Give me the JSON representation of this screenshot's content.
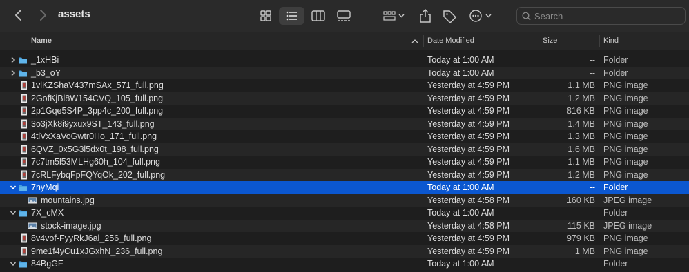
{
  "toolbar": {
    "title": "assets",
    "search_placeholder": "Search",
    "icons": [
      "chevron-left-icon",
      "chevron-right-icon",
      "grid-view-icon",
      "list-view-icon",
      "column-view-icon",
      "gallery-view-icon",
      "group-icon",
      "share-icon",
      "tag-icon",
      "more-icon",
      "search-icon"
    ]
  },
  "columns": {
    "name": "Name",
    "date": "Date Modified",
    "size": "Size",
    "kind": "Kind"
  },
  "colors": {
    "selection": "#0b57d0",
    "folder": "#4aa3df"
  },
  "rows": [
    {
      "name": "_1xHBi",
      "date": "Today at 1:00 AM",
      "size": "--",
      "kind": "Folder",
      "type": "folder",
      "disclosure": "collapsed",
      "indent": 0
    },
    {
      "name": "_b3_oY",
      "date": "Today at 1:00 AM",
      "size": "--",
      "kind": "Folder",
      "type": "folder",
      "disclosure": "collapsed",
      "indent": 0
    },
    {
      "name": "1vlKZShaV437mSAx_571_full.png",
      "date": "Yesterday at 4:59 PM",
      "size": "1.1 MB",
      "kind": "PNG image",
      "type": "png",
      "indent": 0
    },
    {
      "name": "2GofKjBl8W154CVQ_105_full.png",
      "date": "Yesterday at 4:59 PM",
      "size": "1.2 MB",
      "kind": "PNG image",
      "type": "png",
      "indent": 0
    },
    {
      "name": "2p1Gqe5S4P_3pp4c_200_full.png",
      "date": "Yesterday at 4:59 PM",
      "size": "816 KB",
      "kind": "PNG image",
      "type": "png",
      "indent": 0
    },
    {
      "name": "3o3jXk8i9yxux9ST_143_full.png",
      "date": "Yesterday at 4:59 PM",
      "size": "1.4 MB",
      "kind": "PNG image",
      "type": "png",
      "indent": 0
    },
    {
      "name": "4tlVxXaVoGwtr0Ho_171_full.png",
      "date": "Yesterday at 4:59 PM",
      "size": "1.3 MB",
      "kind": "PNG image",
      "type": "png",
      "indent": 0
    },
    {
      "name": "6QVZ_0x5G3l5dx0t_198_full.png",
      "date": "Yesterday at 4:59 PM",
      "size": "1.6 MB",
      "kind": "PNG image",
      "type": "png",
      "indent": 0
    },
    {
      "name": "7c7tm5l53MLHg60h_104_full.png",
      "date": "Yesterday at 4:59 PM",
      "size": "1.1 MB",
      "kind": "PNG image",
      "type": "png",
      "indent": 0
    },
    {
      "name": "7cRLFybqFpFQYqOk_202_full.png",
      "date": "Yesterday at 4:59 PM",
      "size": "1.2 MB",
      "kind": "PNG image",
      "type": "png",
      "indent": 0
    },
    {
      "name": "7nyMqi",
      "date": "Today at 1:00 AM",
      "size": "--",
      "kind": "Folder",
      "type": "folder",
      "disclosure": "expanded",
      "indent": 0,
      "selected": true
    },
    {
      "name": "mountains.jpg",
      "date": "Yesterday at 4:58 PM",
      "size": "160 KB",
      "kind": "JPEG image",
      "type": "jpg",
      "indent": 1
    },
    {
      "name": "7X_cMX",
      "date": "Today at 1:00 AM",
      "size": "--",
      "kind": "Folder",
      "type": "folder",
      "disclosure": "expanded",
      "indent": 0
    },
    {
      "name": "stock-image.jpg",
      "date": "Yesterday at 4:58 PM",
      "size": "115 KB",
      "kind": "JPEG image",
      "type": "jpg",
      "indent": 1
    },
    {
      "name": "8v4vof-FyyRkJ6al_256_full.png",
      "date": "Yesterday at 4:59 PM",
      "size": "979 KB",
      "kind": "PNG image",
      "type": "png",
      "indent": 0
    },
    {
      "name": "9me1f4yCu1xJGxhN_236_full.png",
      "date": "Yesterday at 4:59 PM",
      "size": "1 MB",
      "kind": "PNG image",
      "type": "png",
      "indent": 0
    },
    {
      "name": "84BgGF",
      "date": "Today at 1:00 AM",
      "size": "--",
      "kind": "Folder",
      "type": "folder",
      "disclosure": "expanded",
      "indent": 0
    }
  ]
}
